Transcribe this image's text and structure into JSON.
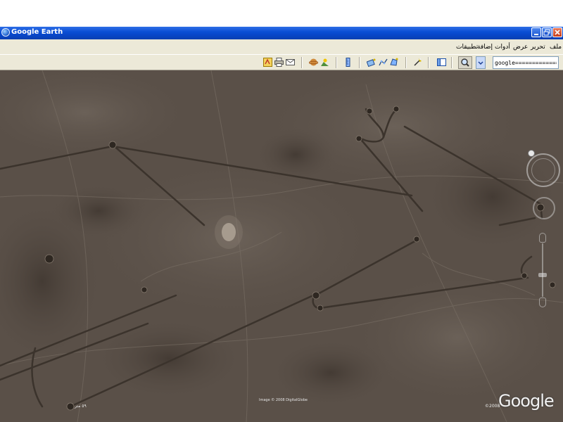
{
  "window": {
    "title": "Google Earth"
  },
  "menu": {
    "items": [
      "ملف",
      "تحرير",
      "عرض",
      "أدوات",
      "إضافة",
      "تطبيقات"
    ]
  },
  "toolbar": {
    "search_value": "google=============1",
    "icons": [
      "hide-sidebar-icon",
      "placemark-icon",
      "polygon-icon",
      "path-icon",
      "image-overlay-icon",
      "ruler-icon",
      "sunlight-icon",
      "sky-icon",
      "email-icon",
      "print-icon",
      "view-in-maps-icon"
    ]
  },
  "map": {
    "copyright": "Image © 2008 DigitalGlobe",
    "scale_label": "٥٩ متر",
    "logo_year": "©2008",
    "logo_text": "Google"
  },
  "colors": {
    "titlebar": "#0a4ed4",
    "chrome": "#ece9d8",
    "terrain": "#5a5048",
    "track_lines": "#3b332c"
  }
}
